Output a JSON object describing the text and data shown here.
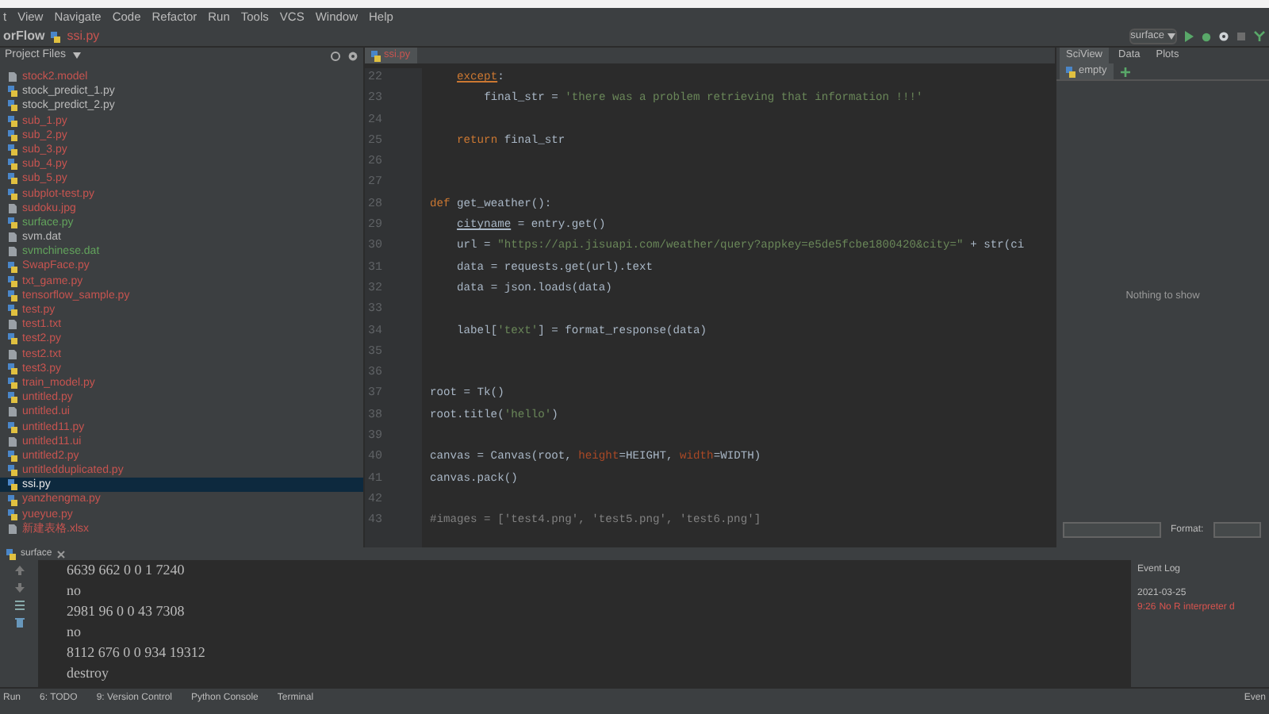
{
  "menu": [
    "t",
    "View",
    "Navigate",
    "Code",
    "Refactor",
    "Run",
    "Tools",
    "VCS",
    "Window",
    "Help"
  ],
  "breadcrumbs": [
    "orFlow",
    "ssi.py"
  ],
  "run_config": {
    "label": "surface"
  },
  "project_panel": {
    "title": "Project Files",
    "files": [
      {
        "name": "stock2.model",
        "kind": "file",
        "color": "#c75450",
        "selected": false
      },
      {
        "name": "stock_predict_1.py",
        "kind": "py",
        "color": "#bbbbbb",
        "selected": false
      },
      {
        "name": "stock_predict_2.py",
        "kind": "py",
        "color": "#bbbbbb",
        "selected": false
      },
      {
        "name": "sub_1.py",
        "kind": "py",
        "color": "#c75450",
        "selected": false
      },
      {
        "name": "sub_2.py",
        "kind": "py",
        "color": "#c75450",
        "selected": false
      },
      {
        "name": "sub_3.py",
        "kind": "py",
        "color": "#c75450",
        "selected": false
      },
      {
        "name": "sub_4.py",
        "kind": "py",
        "color": "#c75450",
        "selected": false
      },
      {
        "name": "sub_5.py",
        "kind": "py",
        "color": "#c75450",
        "selected": false
      },
      {
        "name": "subplot-test.py",
        "kind": "py",
        "color": "#c75450",
        "selected": false
      },
      {
        "name": "sudoku.jpg",
        "kind": "file",
        "color": "#c75450",
        "selected": false
      },
      {
        "name": "surface.py",
        "kind": "py",
        "color": "#62a35c",
        "selected": false
      },
      {
        "name": "svm.dat",
        "kind": "file",
        "color": "#bbbbbb",
        "selected": false
      },
      {
        "name": "svmchinese.dat",
        "kind": "file",
        "color": "#62a35c",
        "selected": false
      },
      {
        "name": "SwapFace.py",
        "kind": "py",
        "color": "#c75450",
        "selected": false
      },
      {
        "name": "txt_game.py",
        "kind": "py",
        "color": "#c75450",
        "selected": false
      },
      {
        "name": "tensorflow_sample.py",
        "kind": "py",
        "color": "#c75450",
        "selected": false
      },
      {
        "name": "test.py",
        "kind": "py",
        "color": "#c75450",
        "selected": false
      },
      {
        "name": "test1.txt",
        "kind": "file",
        "color": "#c75450",
        "selected": false
      },
      {
        "name": "test2.py",
        "kind": "py",
        "color": "#c75450",
        "selected": false
      },
      {
        "name": "test2.txt",
        "kind": "file",
        "color": "#c75450",
        "selected": false
      },
      {
        "name": "test3.py",
        "kind": "py",
        "color": "#c75450",
        "selected": false
      },
      {
        "name": "train_model.py",
        "kind": "py",
        "color": "#c75450",
        "selected": false
      },
      {
        "name": "untitled.py",
        "kind": "py",
        "color": "#c75450",
        "selected": false
      },
      {
        "name": "untitled.ui",
        "kind": "file",
        "color": "#c75450",
        "selected": false
      },
      {
        "name": "untitled11.py",
        "kind": "py",
        "color": "#c75450",
        "selected": false
      },
      {
        "name": "untitled11.ui",
        "kind": "file",
        "color": "#c75450",
        "selected": false
      },
      {
        "name": "untitled2.py",
        "kind": "py",
        "color": "#c75450",
        "selected": false
      },
      {
        "name": "untitledduplicated.py",
        "kind": "py",
        "color": "#c75450",
        "selected": false
      },
      {
        "name": "ssi.py",
        "kind": "py",
        "selected": true
      },
      {
        "name": "yanzhengma.py",
        "kind": "py",
        "color": "#c75450",
        "selected": false
      },
      {
        "name": "yueyue.py",
        "kind": "py",
        "color": "#c75450",
        "selected": false
      },
      {
        "name": "新建表格.xlsx",
        "kind": "file",
        "color": "#c75450",
        "selected": false
      }
    ]
  },
  "editor": {
    "tabs": [
      {
        "label": "ssi.py",
        "selected": true
      }
    ],
    "lines": [
      {
        "number": "22",
        "tokens": [
          {
            "text": "    except",
            "kind": "warnkw"
          },
          {
            "text": ":",
            "kind": "plain"
          }
        ]
      },
      {
        "number": "23",
        "tokens": [
          {
            "text": "        final_str = ",
            "kind": "plain"
          },
          {
            "text": "'there was a problem retrieving that information !!!'",
            "kind": "str"
          }
        ]
      },
      {
        "number": "24"
      },
      {
        "number": "25",
        "tokens": [
          {
            "text": "    return",
            "kind": "kw"
          },
          {
            "text": " final_str",
            "kind": "plain"
          }
        ]
      },
      {
        "number": "26"
      },
      {
        "number": "27"
      },
      {
        "number": "28",
        "tokens": [
          {
            "text": "def",
            "kind": "kw"
          },
          {
            "text": " get_weather():",
            "kind": "plain"
          }
        ]
      },
      {
        "number": "29",
        "tokens": [
          {
            "text": "    cityname",
            "kind": "warn"
          },
          {
            "text": " = entry.get()",
            "kind": "plain"
          }
        ]
      },
      {
        "number": "30",
        "tokens": [
          {
            "text": "    url = ",
            "kind": "plain"
          },
          {
            "text": "\"https://api.jisuapi.com/weather/query?appkey=e5de5fcbe1800420&city=\"",
            "kind": "str"
          },
          {
            "text": " + str(ci",
            "kind": "plain"
          }
        ]
      },
      {
        "number": "31",
        "tokens": [
          {
            "text": "    data = requests.get(url).text",
            "kind": "plain"
          }
        ]
      },
      {
        "number": "32",
        "tokens": [
          {
            "text": "    data = json.loads(data)",
            "kind": "plain"
          }
        ]
      },
      {
        "number": "33"
      },
      {
        "number": "34",
        "tokens": [
          {
            "text": "    label[",
            "kind": "plain"
          },
          {
            "text": "'text'",
            "kind": "str"
          },
          {
            "text": "] = format_response(data)",
            "kind": "plain"
          }
        ]
      },
      {
        "number": "35"
      },
      {
        "number": "36"
      },
      {
        "number": "37",
        "tokens": [
          {
            "text": "root = Tk()",
            "kind": "plain"
          }
        ]
      },
      {
        "number": "38",
        "tokens": [
          {
            "text": "root.title(",
            "kind": "plain"
          },
          {
            "text": "'hello'",
            "kind": "str"
          },
          {
            "text": ")",
            "kind": "plain"
          }
        ]
      },
      {
        "number": "39"
      },
      {
        "number": "40",
        "tokens": [
          {
            "text": "canvas = Canvas(root, ",
            "kind": "plain"
          },
          {
            "text": "height",
            "kind": "param"
          },
          {
            "text": "=HEIGHT, ",
            "kind": "plain"
          },
          {
            "text": "width",
            "kind": "param"
          },
          {
            "text": "=WIDTH)",
            "kind": "plain"
          }
        ]
      },
      {
        "number": "41",
        "tokens": [
          {
            "text": "canvas.pack()",
            "kind": "plain"
          }
        ]
      },
      {
        "number": "42"
      },
      {
        "number": "43",
        "tokens": [
          {
            "text": "#images = ['test4.png', 'test5.png', 'test6.png']",
            "kind": "cmt"
          }
        ]
      }
    ]
  },
  "sciview": {
    "tabs": [
      {
        "label": "SciView",
        "selected": true
      },
      {
        "label": "Data",
        "selected": false
      },
      {
        "label": "Plots",
        "selected": false
      }
    ],
    "subtab": "empty",
    "message": "Nothing to show",
    "format_label": "Format:"
  },
  "run_panel": {
    "tab": "surface",
    "output": [
      "6639 662 0 0 1 7240",
      "no",
      "2981 96 0 0 43 7308",
      "no",
      "8112 676 0 0 934 19312",
      "destroy"
    ]
  },
  "event_log": {
    "title": "Event Log",
    "date": "2021-03-25",
    "time": "9:26",
    "message": "No R interpreter d"
  },
  "tool_tabs": [
    "Run",
    "6: TODO",
    "9: Version Control",
    "Python Console",
    "Terminal"
  ],
  "event_log_button": "Even"
}
